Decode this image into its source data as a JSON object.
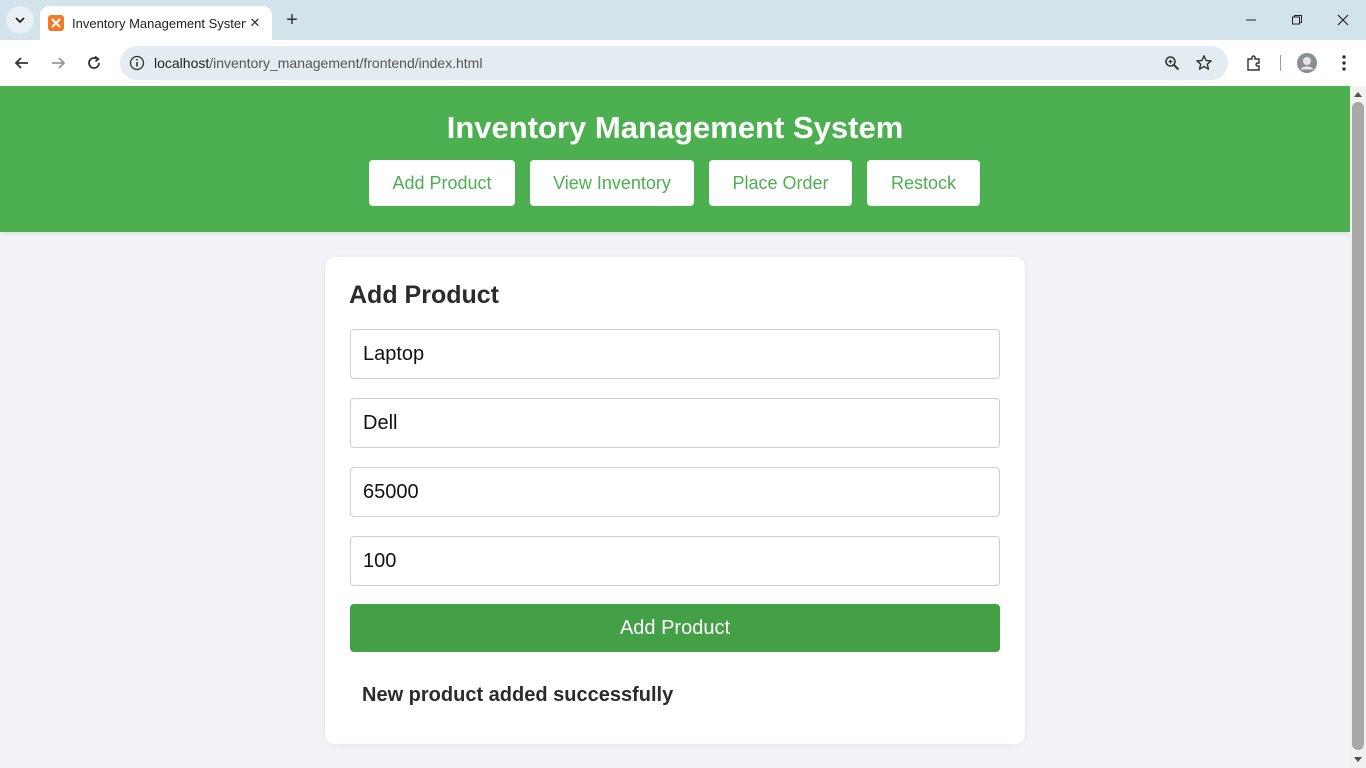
{
  "browser": {
    "tab_title": "Inventory Management System",
    "url_host": "localhost",
    "url_path": "/inventory_management/frontend/index.html"
  },
  "header": {
    "title": "Inventory Management System",
    "nav": [
      "Add Product",
      "View Inventory",
      "Place Order",
      "Restock"
    ]
  },
  "form": {
    "title": "Add Product",
    "fields": [
      "Laptop",
      "Dell",
      "65000",
      "100"
    ],
    "submit_label": "Add Product",
    "message": "New product added successfully"
  },
  "colors": {
    "header_bg": "#4caf50",
    "button_bg": "#43a047",
    "page_bg": "#f2f3f6"
  }
}
